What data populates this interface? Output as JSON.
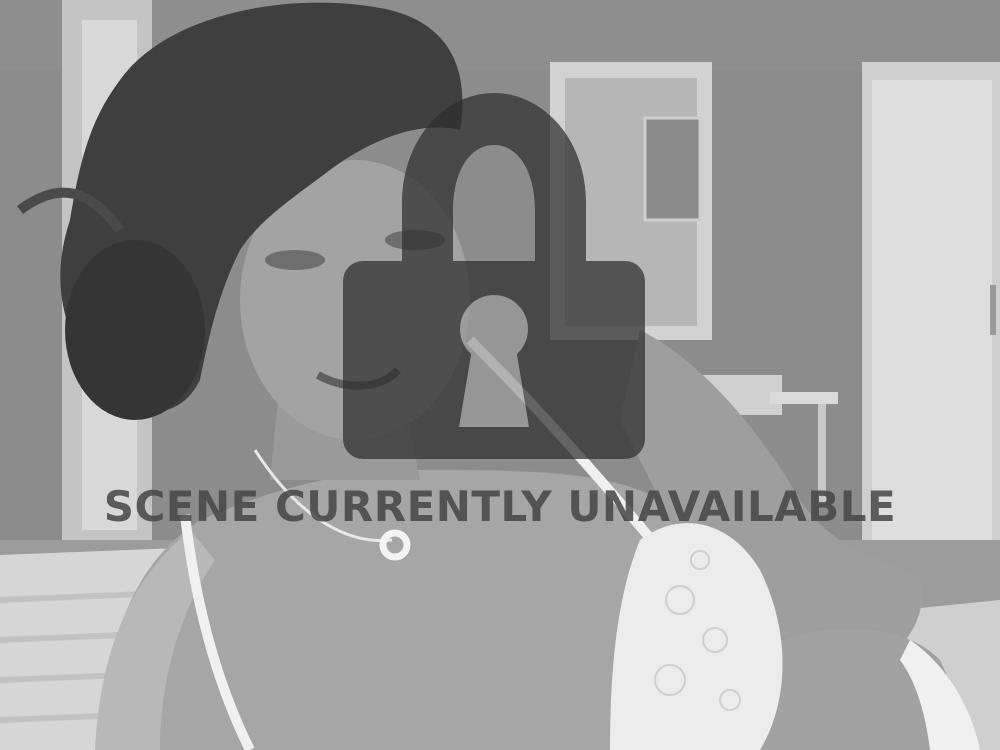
{
  "overlay": {
    "message": "SCENE CURRENTLY UNAVAILABLE",
    "icon": "padlock-locked-icon",
    "icon_color": "#2e2e2e",
    "text_color": "#464646"
  },
  "scene": {
    "palette": "grayscale",
    "background_color": "#8a8a8a",
    "accent_white": "#f2f2f2"
  }
}
